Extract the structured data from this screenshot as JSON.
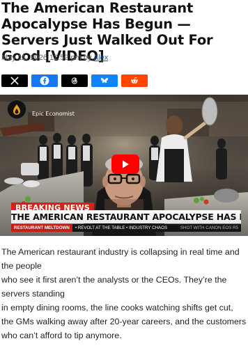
{
  "article": {
    "title": "The American Restaurant Apocalypse Has Begun — Servers Just Walked Out For Good [VIDEO]",
    "date": "May 11, 2026 12:52 pm",
    "by_label": "by",
    "author": "Alex"
  },
  "share": [
    {
      "name": "x",
      "icon": "x-icon",
      "color": "#000000"
    },
    {
      "name": "facebook",
      "icon": "facebook-icon",
      "color": "#1877f2"
    },
    {
      "name": "threads",
      "icon": "threads-icon",
      "color": "#000000"
    },
    {
      "name": "bluesky",
      "icon": "bluesky-icon",
      "color": "#1185fe"
    },
    {
      "name": "reddit",
      "icon": "reddit-icon",
      "color": "#ff4500"
    }
  ],
  "video": {
    "channel": "Epic Economist",
    "breaking": "BREAKING NEWS",
    "banner": "THE AMERICAN RESTAURANT APOCALYPSE HAS BEGUN",
    "ticker_tag": "RESTAURANT MELTDOWN",
    "ticker_items": "• REVOLT AT THE TABLE • INDUSTRY CHAOS",
    "ticker_shot": "SHOT WITH CANON EOS R5"
  },
  "body_lines": [
    "The American restaurant industry is collapsing in real time and",
    "the people",
    "who see it first aren’t the analysts or the CEOs. They’re the",
    "servers standing",
    "in empty dining rooms, the line cooks watching shifts get cut,",
    "the GMs walking away after 20-year careers, and the customers",
    "who can’t afford to tip anymore."
  ]
}
